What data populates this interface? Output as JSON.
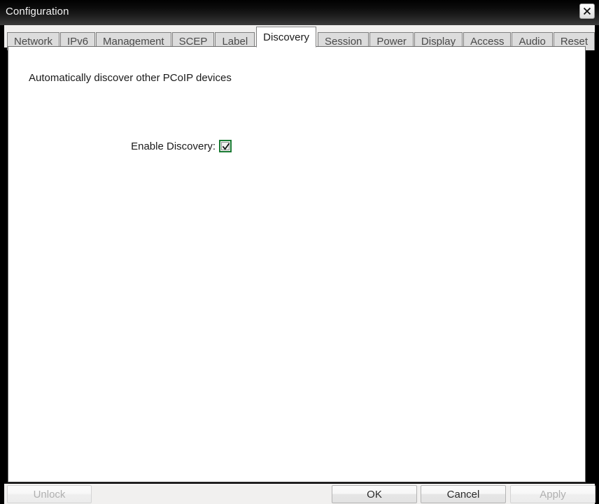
{
  "window": {
    "title": "Configuration",
    "close_icon": "close-icon",
    "close_label": "×"
  },
  "tabs": [
    {
      "label": "Network",
      "active": false
    },
    {
      "label": "IPv6",
      "active": false
    },
    {
      "label": "Management",
      "active": false
    },
    {
      "label": "SCEP",
      "active": false
    },
    {
      "label": "Label",
      "active": false
    },
    {
      "label": "Discovery",
      "active": true
    },
    {
      "label": "Session",
      "active": false
    },
    {
      "label": "Power",
      "active": false
    },
    {
      "label": "Display",
      "active": false
    },
    {
      "label": "Access",
      "active": false
    },
    {
      "label": "Audio",
      "active": false
    },
    {
      "label": "Reset",
      "active": false
    }
  ],
  "content": {
    "heading": "Automatically discover other PCoIP devices",
    "field": {
      "label": "Enable Discovery:",
      "checkbox_name": "enable-discovery-checkbox",
      "checked": true,
      "focus_color": "#1a7a33"
    }
  },
  "footer": {
    "unlock_label": "Unlock",
    "unlock_enabled": false,
    "ok_label": "OK",
    "ok_enabled": true,
    "cancel_label": "Cancel",
    "cancel_enabled": true,
    "apply_label": "Apply",
    "apply_enabled": false
  }
}
